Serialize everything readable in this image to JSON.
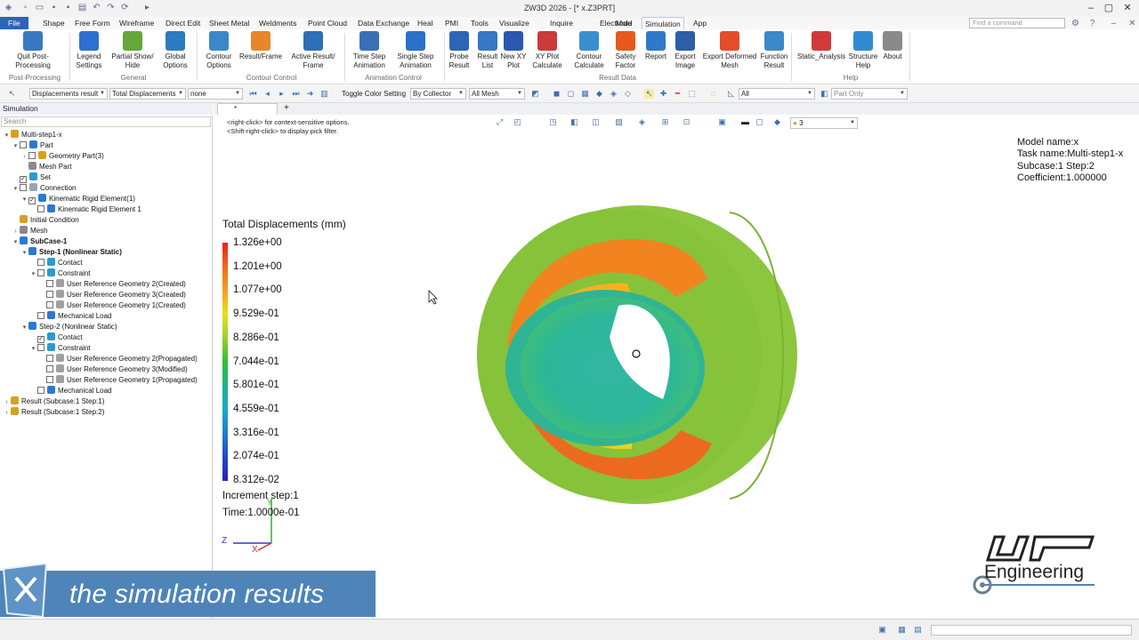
{
  "window": {
    "title": "ZW3D 2026        - [* x.Z3PRT]"
  },
  "menu": {
    "items": [
      "File",
      "Shape",
      "Free Form",
      "Wireframe",
      "Direct Edit",
      "Sheet Metal",
      "Weldments",
      "Point Cloud",
      "Data Exchange",
      "Heal",
      "PMI",
      "Tools",
      "Visualize",
      "Inquire",
      "Electrode",
      "Mold",
      "Simulation",
      "App"
    ],
    "active": "Simulation",
    "find_placeholder": "Find a command"
  },
  "ribbon": {
    "buttons": [
      {
        "label": "Quit Post-\nProcessing",
        "icon": "quit-post-processing-icon"
      },
      {
        "label": "Legend\nSettings",
        "icon": "legend-settings-icon"
      },
      {
        "label": "Partial Show/\nHide",
        "icon": "partial-show-hide-icon"
      },
      {
        "label": "Global\nOptions",
        "icon": "global-options-icon"
      },
      {
        "label": "Contour\nOptions",
        "icon": "contour-options-icon"
      },
      {
        "label": "Result/Frame",
        "icon": "result-frame-icon"
      },
      {
        "label": "Active Result/\nFrame",
        "icon": "active-result-frame-icon"
      },
      {
        "label": "Time Step\nAnimation",
        "icon": "time-step-animation-icon"
      },
      {
        "label": "Single Step\nAnimation",
        "icon": "single-step-animation-icon"
      },
      {
        "label": "Probe\nResult",
        "icon": "probe-result-icon"
      },
      {
        "label": "Result\nList",
        "icon": "result-list-icon"
      },
      {
        "label": "New XY\nPlot",
        "icon": "new-xy-plot-icon"
      },
      {
        "label": "XY Plot\nCalculate",
        "icon": "xy-plot-calculate-icon"
      },
      {
        "label": "Contour\nCalculate",
        "icon": "contour-calculate-icon"
      },
      {
        "label": "Safety\nFactor",
        "icon": "safety-factor-icon"
      },
      {
        "label": "Report",
        "icon": "report-icon"
      },
      {
        "label": "Export\nImage",
        "icon": "export-image-icon"
      },
      {
        "label": "Export Deformed\nMesh",
        "icon": "export-deformed-mesh-icon"
      },
      {
        "label": "Function\nResult",
        "icon": "function-result-icon"
      },
      {
        "label": "Static_Analysis",
        "icon": "static-analysis-icon"
      },
      {
        "label": "Structure\nHelp",
        "icon": "structure-help-icon"
      },
      {
        "label": "About",
        "icon": "about-icon"
      }
    ],
    "groups": [
      "Post-Processing",
      "General",
      "Contour Control",
      "Animation Control",
      "Result Data",
      "Help"
    ]
  },
  "toolbar": {
    "result_type": "Displacements result",
    "component": "Total Displacements",
    "none": "none",
    "toggle_color": "Toggle Color Setting",
    "collector": "By Collector",
    "mesh": "All Mesh",
    "filter": "All",
    "part_only": "Part Only"
  },
  "left_panel": {
    "title": "Simulation",
    "search_placeholder": "Search",
    "tree": [
      {
        "label": "Multi-step1-x",
        "depth": 0,
        "tw": "▾",
        "cb": null,
        "bold": false
      },
      {
        "label": "Part",
        "depth": 1,
        "tw": "▾",
        "cb": "",
        "bold": false
      },
      {
        "label": "Geometry Part(3)",
        "depth": 2,
        "tw": "›",
        "cb": "",
        "bold": false
      },
      {
        "label": "Mesh Part",
        "depth": 2,
        "tw": "",
        "cb": null,
        "bold": false
      },
      {
        "label": "Set",
        "depth": 1,
        "tw": "",
        "cb": "✓",
        "bold": false
      },
      {
        "label": "Connection",
        "depth": 1,
        "tw": "▾",
        "cb": "",
        "bold": false
      },
      {
        "label": "Kinematic Rigid Element(1)",
        "depth": 2,
        "tw": "▾",
        "cb": "✓",
        "bold": false
      },
      {
        "label": "Kinematic Rigid Element 1",
        "depth": 3,
        "tw": "",
        "cb": "",
        "bold": false
      },
      {
        "label": "Initial Condition",
        "depth": 1,
        "tw": "",
        "cb": null,
        "bold": false
      },
      {
        "label": "Mesh",
        "depth": 1,
        "tw": "›",
        "cb": null,
        "bold": false
      },
      {
        "label": "SubCase-1",
        "depth": 1,
        "tw": "▾",
        "cb": null,
        "bold": true
      },
      {
        "label": "Step-1 (Nonlinear Static)",
        "depth": 2,
        "tw": "▾",
        "cb": null,
        "bold": true
      },
      {
        "label": "Contact",
        "depth": 3,
        "tw": "",
        "cb": "",
        "bold": false
      },
      {
        "label": "Constraint",
        "depth": 3,
        "tw": "▾",
        "cb": "",
        "bold": false
      },
      {
        "label": "User Reference Geometry 2(Created)",
        "depth": 4,
        "tw": "",
        "cb": "",
        "bold": false
      },
      {
        "label": "User Reference Geometry 3(Created)",
        "depth": 4,
        "tw": "",
        "cb": "",
        "bold": false
      },
      {
        "label": "User Reference Geometry 1(Created)",
        "depth": 4,
        "tw": "",
        "cb": "",
        "bold": false
      },
      {
        "label": "Mechanical Load",
        "depth": 3,
        "tw": "",
        "cb": "",
        "bold": false
      },
      {
        "label": "Step-2 (Nonlinear Static)",
        "depth": 2,
        "tw": "▾",
        "cb": null,
        "bold": false
      },
      {
        "label": "Contact",
        "depth": 3,
        "tw": "",
        "cb": "✓",
        "bold": false
      },
      {
        "label": "Constraint",
        "depth": 3,
        "tw": "▾",
        "cb": "",
        "bold": false
      },
      {
        "label": "User Reference Geometry 2(Propagated)",
        "depth": 4,
        "tw": "",
        "cb": "",
        "bold": false
      },
      {
        "label": "User Reference Geometry 3(Modified)",
        "depth": 4,
        "tw": "",
        "cb": "",
        "bold": false
      },
      {
        "label": "User Reference Geometry 1(Propagated)",
        "depth": 4,
        "tw": "",
        "cb": "",
        "bold": false
      },
      {
        "label": "Mechanical Load",
        "depth": 3,
        "tw": "",
        "cb": "",
        "bold": false
      },
      {
        "label": "Result (Subcase:1 Step:1)",
        "depth": 0,
        "tw": "›",
        "cb": null,
        "bold": false
      },
      {
        "label": "Result (Subcase:1 Step:2)",
        "depth": 0,
        "tw": "›",
        "cb": null,
        "bold": false
      }
    ]
  },
  "viewport": {
    "tab": "* x.Z3PRT",
    "hint1": "<right-click> for context-sensitive options.",
    "hint2": "<Shift-right-click> to display pick filter.",
    "light_count": "3",
    "info": {
      "model": "Model name:x",
      "task": "Task name:Multi-step1-x",
      "subcase": "Subcase:1  Step:2",
      "coeff": "Coefficient:1.000000"
    },
    "legend": {
      "title": "Total Displacements (mm)",
      "values": [
        "1.326e+00",
        "1.201e+00",
        "1.077e+00",
        "9.529e-01",
        "8.286e-01",
        "7.044e-01",
        "5.801e-01",
        "4.559e-01",
        "3.316e-01",
        "2.074e-01",
        "8.312e-02"
      ]
    },
    "increment": "Increment step:1",
    "time": "Time:1.0000e-01",
    "axis_z": "Z",
    "axis_x": "X",
    "axis_y": "Y"
  },
  "caption": {
    "text": "the simulation results"
  },
  "logo": {
    "text": "Engineering"
  },
  "colors": {
    "ribbon_blue": "#2d63b8",
    "caption_bg": "#4e84b8",
    "part_green": "#8cc63f"
  }
}
